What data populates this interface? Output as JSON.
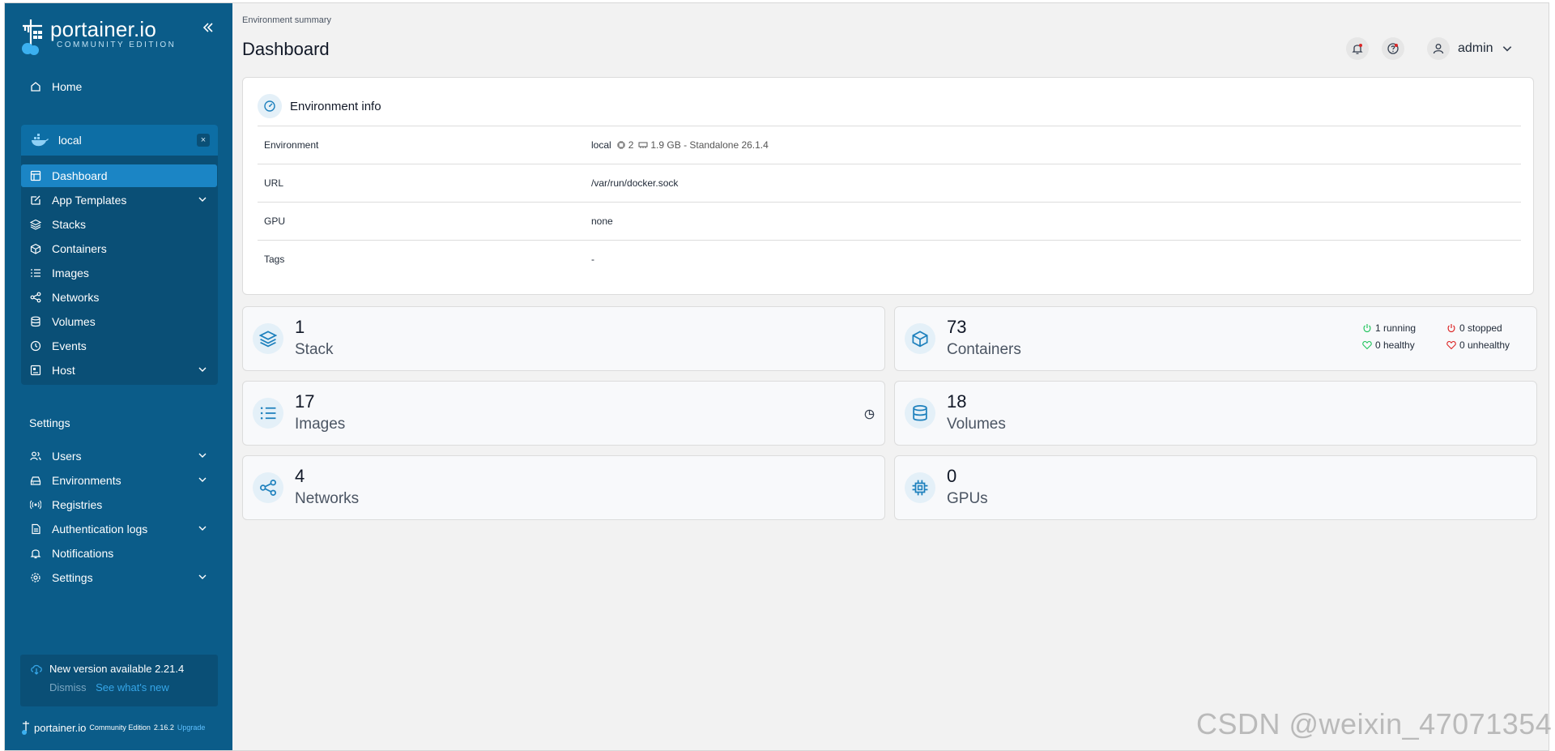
{
  "sidebar": {
    "brand": "portainer.io",
    "edition": "COMMUNITY EDITION",
    "home_label": "Home",
    "environment": {
      "name": "local",
      "close": "×",
      "items": [
        {
          "label": "Dashboard",
          "icon": "dashboard-icon"
        },
        {
          "label": "App Templates",
          "icon": "edit-icon"
        },
        {
          "label": "Stacks",
          "icon": "layers-icon"
        },
        {
          "label": "Containers",
          "icon": "box-icon"
        },
        {
          "label": "Images",
          "icon": "list-icon"
        },
        {
          "label": "Networks",
          "icon": "share-icon"
        },
        {
          "label": "Volumes",
          "icon": "database-icon"
        },
        {
          "label": "Events",
          "icon": "clock-icon"
        },
        {
          "label": "Host",
          "icon": "server-icon"
        }
      ]
    },
    "settings_title": "Settings",
    "settings_items": [
      {
        "label": "Users",
        "icon": "users-icon"
      },
      {
        "label": "Environments",
        "icon": "hdd-icon"
      },
      {
        "label": "Registries",
        "icon": "radio-icon"
      },
      {
        "label": "Authentication logs",
        "icon": "file-icon"
      },
      {
        "label": "Notifications",
        "icon": "bell-icon"
      },
      {
        "label": "Settings",
        "icon": "gear-icon"
      }
    ],
    "update": {
      "title": "New version available 2.21.4",
      "dismiss": "Dismiss",
      "whats_new": "See what's new"
    },
    "footer": {
      "brand": "portainer.io",
      "edition": "Community Edition",
      "version": "2.16.2",
      "upgrade": "Upgrade"
    }
  },
  "header": {
    "breadcrumb": "Environment summary",
    "title": "Dashboard",
    "username": "admin"
  },
  "env_info": {
    "title": "Environment info",
    "rows": {
      "environment": {
        "key": "Environment",
        "name": "local",
        "cpu": "2",
        "memory": "1.9 GB - Standalone 26.1.4"
      },
      "url": {
        "key": "URL",
        "value": "/var/run/docker.sock"
      },
      "gpu": {
        "key": "GPU",
        "value": "none"
      },
      "tags": {
        "key": "Tags",
        "value": "-"
      }
    }
  },
  "stats": {
    "stack": {
      "value": "1",
      "label": "Stack"
    },
    "containers": {
      "value": "73",
      "label": "Containers",
      "running": "1 running",
      "stopped": "0 stopped",
      "healthy": "0 healthy",
      "unhealthy": "0 unhealthy"
    },
    "images": {
      "value": "17",
      "label": "Images"
    },
    "volumes": {
      "value": "18",
      "label": "Volumes"
    },
    "networks": {
      "value": "4",
      "label": "Networks"
    },
    "gpus": {
      "value": "0",
      "label": "GPUs"
    }
  },
  "colors": {
    "sidebar": "#0b5c89",
    "active": "#1b85c5",
    "accent": "#1d80bd",
    "running": "#22c55e",
    "stopped": "#dc2626"
  },
  "watermark": "CSDN @weixin_47071354"
}
